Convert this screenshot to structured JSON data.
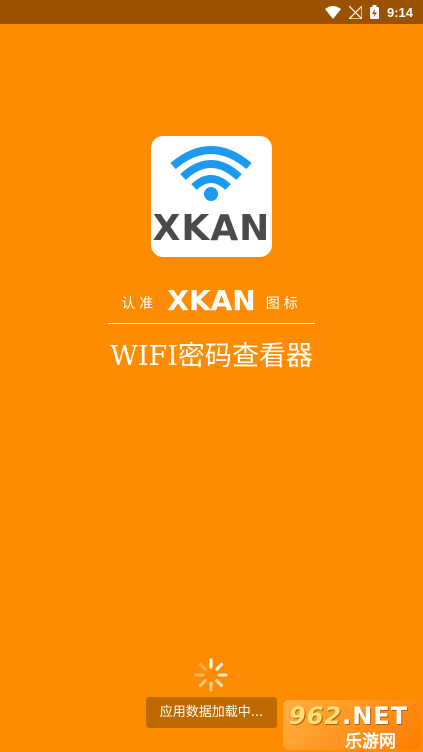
{
  "status_bar": {
    "time": "9:14"
  },
  "logo": {
    "text": "XKAN"
  },
  "certify": {
    "left": "认准",
    "brand": "XKAN",
    "right": "图标"
  },
  "app": {
    "title": "WIFI密码查看器"
  },
  "loading": {
    "message": "应用数据加载中..."
  },
  "watermark": {
    "top_num": "962",
    "top_suffix": ".NET",
    "bottom": "乐游网"
  },
  "colors": {
    "background": "#FF8C00",
    "status_bar": "#9B5200",
    "wifi_blue": "#1A9AF0"
  }
}
